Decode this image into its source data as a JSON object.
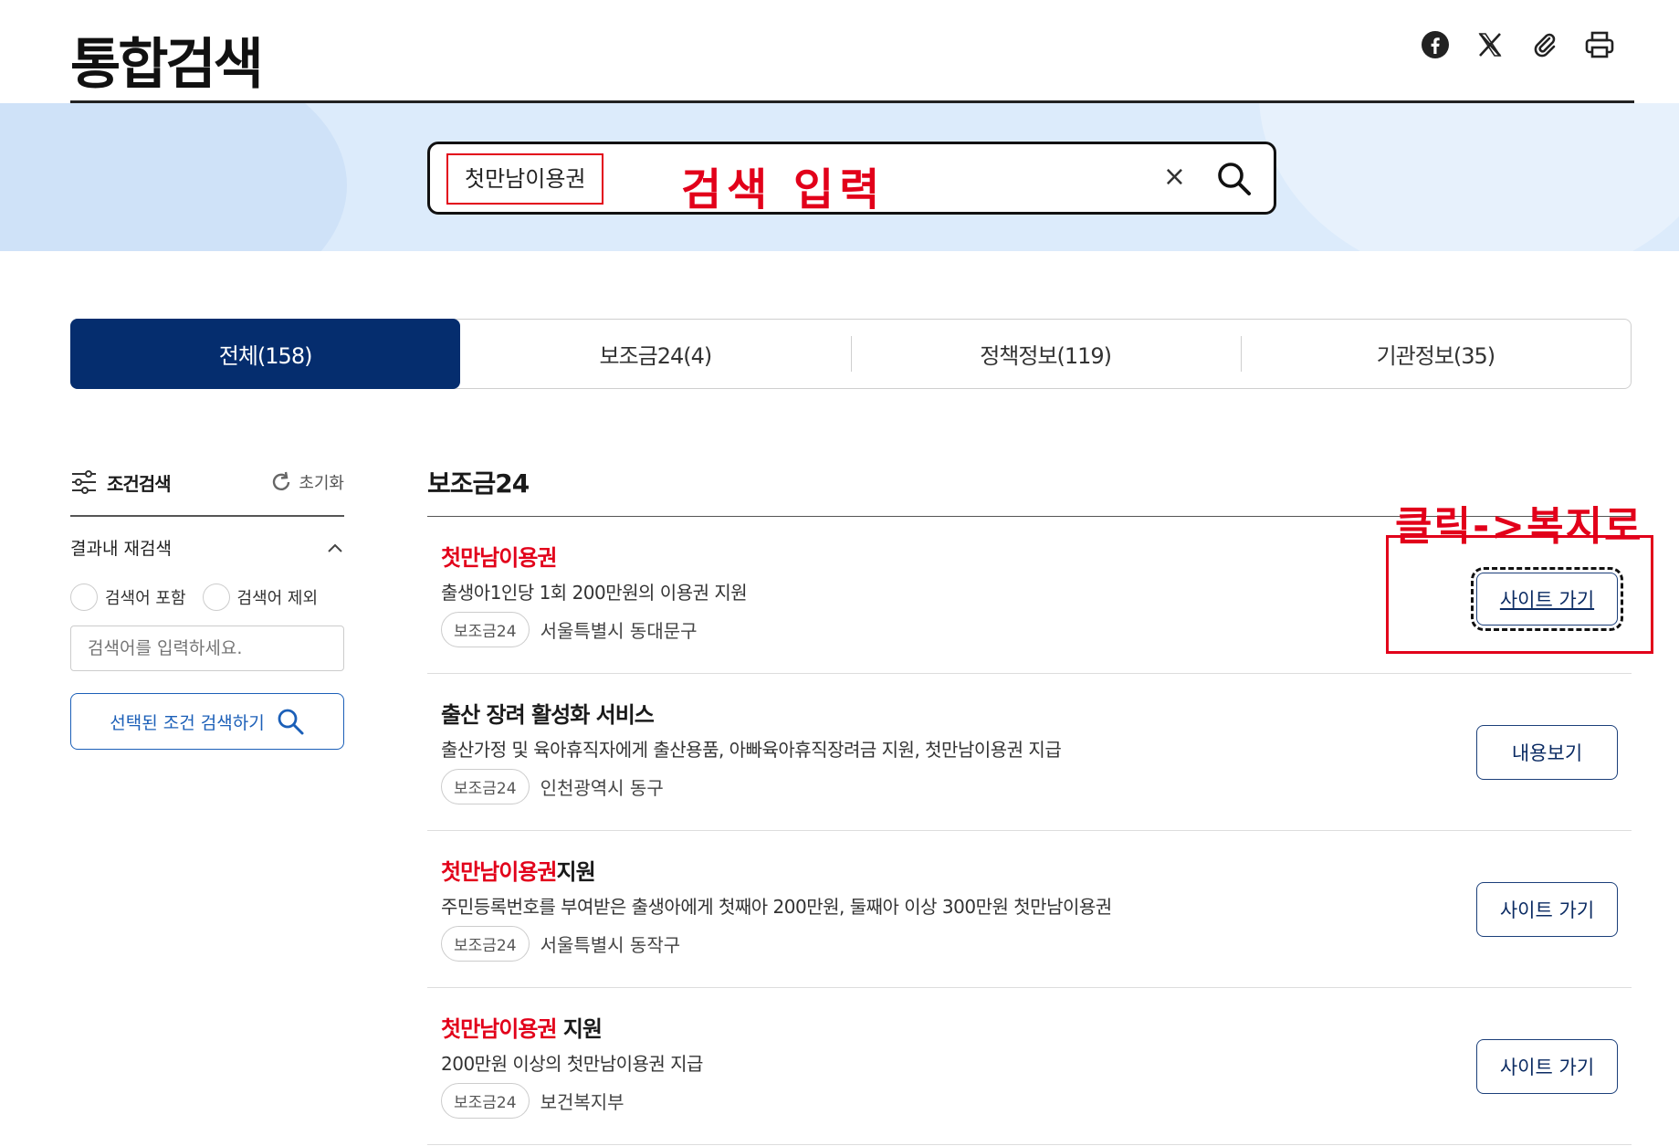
{
  "header": {
    "title": "통합검색",
    "share_icons": [
      "facebook-icon",
      "x-icon",
      "link-icon",
      "print-icon"
    ]
  },
  "search": {
    "query": "첫만남이용권",
    "annotation": "검색 입력",
    "clear_label": "×"
  },
  "tabs": [
    {
      "label": "전체(158)",
      "active": true
    },
    {
      "label": "보조금24(4)",
      "active": false
    },
    {
      "label": "정책정보(119)",
      "active": false
    },
    {
      "label": "기관정보(35)",
      "active": false
    }
  ],
  "sidebar": {
    "title": "조건검색",
    "reset_label": "초기화",
    "refine_label": "결과내 재검색",
    "include_label": "검색어 포함",
    "exclude_label": "검색어 제외",
    "input_placeholder": "검색어를 입력하세요.",
    "submit_label": "선택된 조건 검색하기"
  },
  "section": {
    "title": "보조금24",
    "annotation": "클릭->복지로"
  },
  "results": [
    {
      "title_hl": "첫만남이용권",
      "title_rest": "",
      "desc": "출생아1인당 1회 200만원의 이용권 지원",
      "badge": "보조금24",
      "region": "서울특별시 동대문구",
      "button": "사이트 가기"
    },
    {
      "title_hl": "",
      "title_rest": "출산 장려 활성화 서비스",
      "desc": "출산가정 및 육아휴직자에게 출산용품, 아빠육아휴직장려금 지원, 첫만남이용권 지급",
      "badge": "보조금24",
      "region": "인천광역시 동구",
      "button": "내용보기"
    },
    {
      "title_hl": "첫만남이용권",
      "title_rest": "지원",
      "desc": "주민등록번호를 부여받은 출생아에게 첫째아 200만원, 둘째아 이상 300만원 첫만남이용권",
      "badge": "보조금24",
      "region": "서울특별시 동작구",
      "button": "사이트 가기"
    },
    {
      "title_hl": "첫만남이용권",
      "title_rest": " 지원",
      "desc": "200만원 이상의 첫만남이용권 지급",
      "badge": "보조금24",
      "region": "보건복지부",
      "button": "사이트 가기"
    }
  ],
  "colors": {
    "accent": "#052d6e",
    "highlight": "#e2001a",
    "banner": "#dcebfb"
  }
}
